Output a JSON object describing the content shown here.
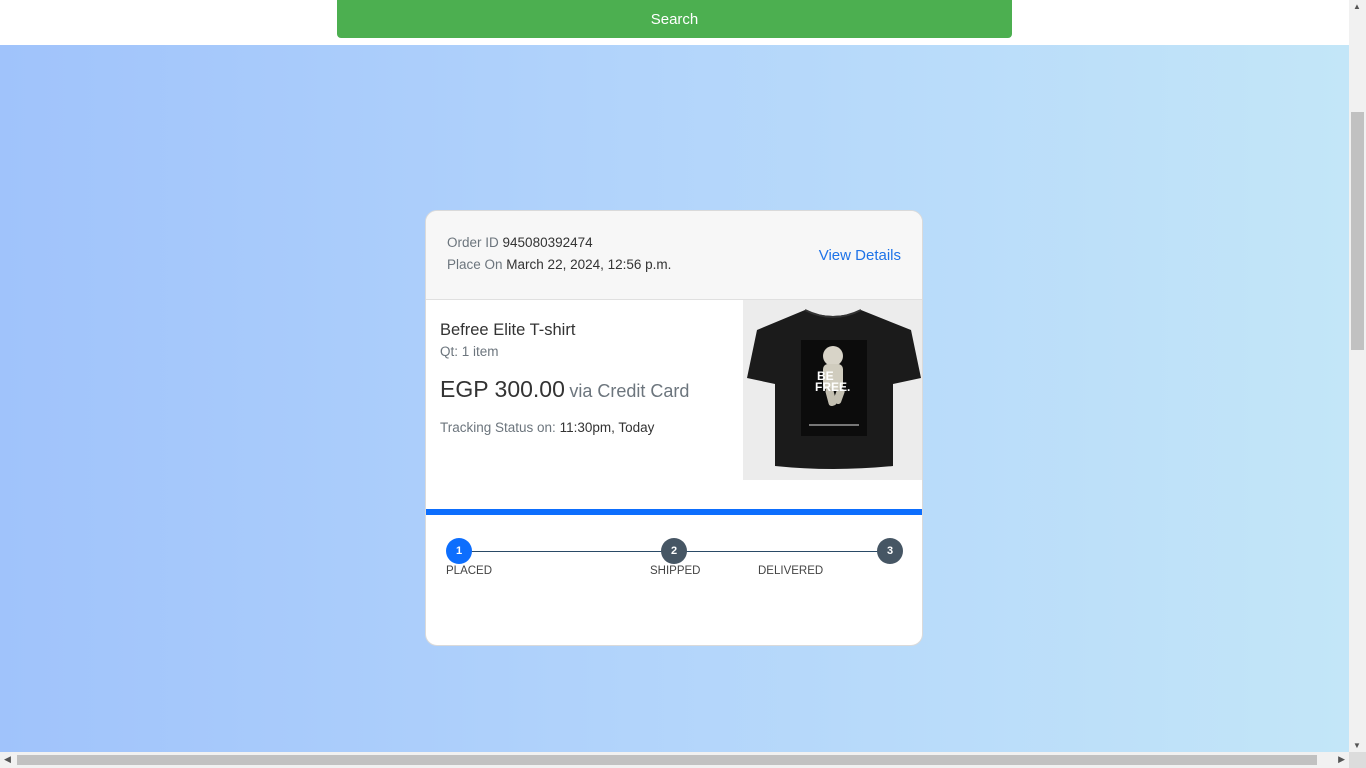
{
  "header": {
    "search_label": "Search"
  },
  "order": {
    "id_label": "Order ID",
    "id_value": "945080392474",
    "placed_label": "Place On",
    "placed_value": "March 22, 2024, 12:56 p.m.",
    "view_details": "View Details"
  },
  "product": {
    "name": "Befree Elite T-shirt",
    "qty": "Qt: 1 item",
    "price": "EGP 300.00",
    "payment": "via Credit Card",
    "tracking_label": "Tracking Status on:",
    "tracking_value": "11:30pm, Today",
    "image_text": "BE FREE."
  },
  "progress": {
    "fraction": 1.0,
    "color": "#0d6efd"
  },
  "steps": [
    {
      "num": "1",
      "label": "PLACED",
      "state": "active"
    },
    {
      "num": "2",
      "label": "SHIPPED",
      "state": "inactive"
    },
    {
      "num": "3",
      "label": "DELIVERED",
      "state": "inactive"
    }
  ],
  "colors": {
    "search_button": "#4caf50",
    "link": "#1e73e8",
    "bg_gradient_start": "#a0c3fb",
    "bg_gradient_end": "#c3e6f8"
  }
}
